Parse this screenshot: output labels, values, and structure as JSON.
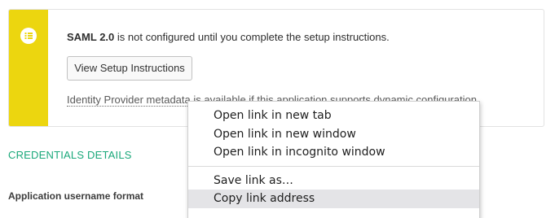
{
  "notice": {
    "icon": "list-icon",
    "stripe_color": "#ecd60f",
    "bold_text": "SAML 2.0",
    "message_text": " is not configured until you complete the setup instructions.",
    "button_label": "View Setup Instructions",
    "idp_link_text": "Identity Provider metadata",
    "idp_rest_text": " is available if this application supports dynamic configuration."
  },
  "section": {
    "title": "CREDENTIALS DETAILS",
    "title_color": "#1aa87a"
  },
  "fields": {
    "username_format_label": "Application username format"
  },
  "context_menu": {
    "group1": [
      {
        "label": "Open link in new tab"
      },
      {
        "label": "Open link in new window"
      },
      {
        "label": "Open link in incognito window"
      }
    ],
    "group2": [
      {
        "label": "Save link as…"
      },
      {
        "label": "Copy link address",
        "highlighted": true
      }
    ]
  }
}
